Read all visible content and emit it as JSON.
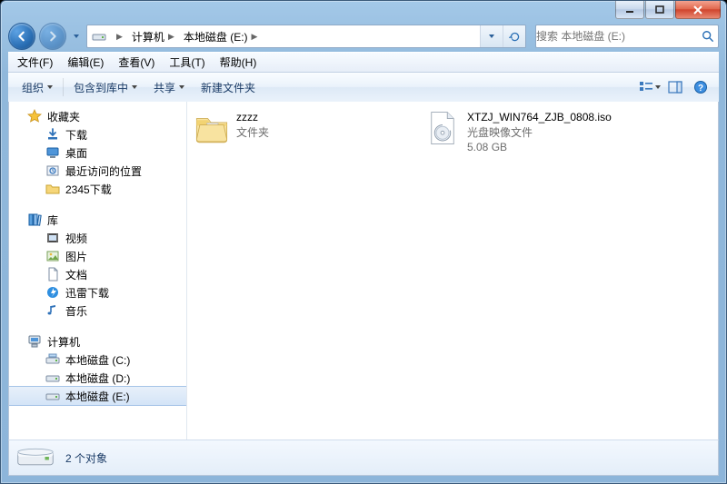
{
  "titlebar": {
    "minimize_tip": "最小化",
    "maximize_tip": "最大化",
    "close_tip": "关闭"
  },
  "nav": {
    "back_label": "后退",
    "forward_label": "前进"
  },
  "address": {
    "crumbs": [
      "计算机",
      "本地磁盘 (E:)"
    ],
    "refresh_label": "刷新"
  },
  "search": {
    "placeholder": "搜索 本地磁盘 (E:)"
  },
  "menubar": {
    "items": [
      "文件(F)",
      "编辑(E)",
      "查看(V)",
      "工具(T)",
      "帮助(H)"
    ]
  },
  "toolbar": {
    "organize": "组织",
    "include": "包含到库中",
    "share": "共享",
    "newfolder": "新建文件夹",
    "view_tip": "更改视图",
    "preview_tip": "显示预览窗格",
    "help_tip": "获取帮助"
  },
  "sidebar": {
    "favorites": {
      "label": "收藏夹",
      "items": [
        "下载",
        "桌面",
        "最近访问的位置",
        "2345下载"
      ]
    },
    "libraries": {
      "label": "库",
      "items": [
        "视频",
        "图片",
        "文档",
        "迅雷下载",
        "音乐"
      ]
    },
    "computer": {
      "label": "计算机",
      "items": [
        "本地磁盘 (C:)",
        "本地磁盘 (D:)",
        "本地磁盘 (E:)"
      ],
      "selected_index": 2
    }
  },
  "content": {
    "items": [
      {
        "name": "zzzz",
        "type_label": "文件夹",
        "kind": "folder"
      },
      {
        "name": "XTZJ_WIN764_ZJB_0808.iso",
        "type_label": "光盘映像文件",
        "size": "5.08 GB",
        "kind": "iso"
      }
    ]
  },
  "details": {
    "status_text": "2 个对象"
  }
}
